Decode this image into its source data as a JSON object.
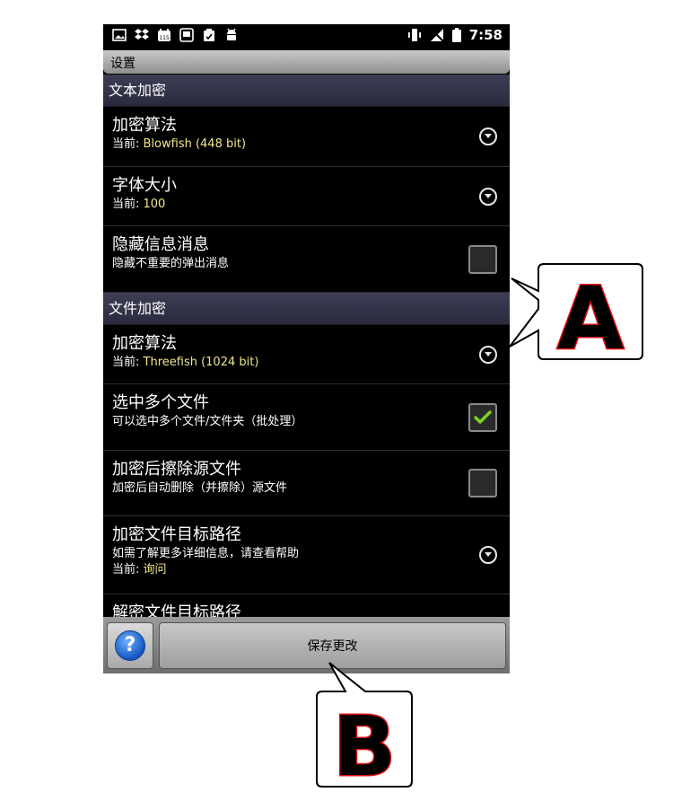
{
  "status_bar": {
    "time": "7:58",
    "left_icons": [
      "image-icon",
      "dropbox-icon",
      "calendar-icon",
      "gallery-icon",
      "clipboard-icon",
      "android-icon"
    ],
    "right_icons": [
      "vibrate-icon",
      "no-signal-icon",
      "battery-icon"
    ]
  },
  "title": "设置",
  "sections": [
    {
      "header": "文本加密",
      "items": [
        {
          "title": "加密算法",
          "subtitle_prefix": "当前: ",
          "value": "Blowfish (448 bit)",
          "control": "dropdown"
        },
        {
          "title": "字体大小",
          "subtitle_prefix": "当前: ",
          "value": "100",
          "control": "dropdown"
        },
        {
          "title": "隐藏信息消息",
          "subtitle": "隐藏不重要的弹出消息",
          "control": "checkbox",
          "checked": false
        }
      ]
    },
    {
      "header": "文件加密",
      "items": [
        {
          "title": "加密算法",
          "subtitle_prefix": "当前: ",
          "value": "Threefish (1024 bit)",
          "control": "dropdown"
        },
        {
          "title": "选中多个文件",
          "subtitle": "可以选中多个文件/文件夹（批处理）",
          "control": "checkbox",
          "checked": true
        },
        {
          "title": "加密后擦除源文件",
          "subtitle": "加密后自动删除（并擦除）源文件",
          "control": "checkbox",
          "checked": false
        },
        {
          "title": "加密文件目标路径",
          "subtitle": "如需了解更多详细信息，请查看帮助",
          "subtitle_prefix": "当前: ",
          "value": "询问",
          "control": "dropdown"
        },
        {
          "title": "解密文件目标路径"
        }
      ]
    }
  ],
  "bottom_bar": {
    "help_icon": "?",
    "save_label": "保存更改"
  },
  "callouts": {
    "a": "A",
    "b": "B"
  },
  "colors": {
    "value_text": "#f0e68c",
    "section_header": "#3d3d55",
    "checkmark": "#7ed321",
    "callout_stroke": "#e01010"
  }
}
